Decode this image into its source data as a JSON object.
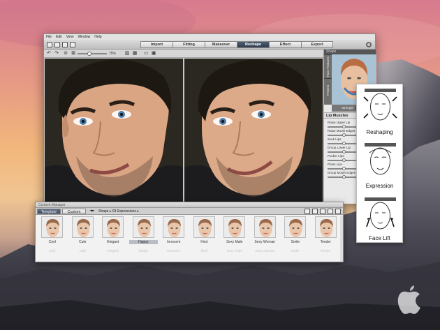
{
  "menu": [
    "File",
    "Edit",
    "View",
    "Window",
    "Help"
  ],
  "tabs": [
    {
      "label": "Import",
      "active": false
    },
    {
      "label": "Fitting",
      "active": false
    },
    {
      "label": "Makeover",
      "active": false
    },
    {
      "label": "Reshape",
      "active": true
    },
    {
      "label": "Effect",
      "active": false
    },
    {
      "label": "Export",
      "active": false
    }
  ],
  "zoom": "75%",
  "right_panel": {
    "header": "Shape",
    "vtabs": [
      "Face Features",
      "Presets"
    ],
    "strength_label": "Strength",
    "section_title": "Lip Muscles",
    "sliders": [
      {
        "label": "Raise Upper Lip",
        "value": 0.5
      },
      {
        "label": "Raise Mouth Edges",
        "value": 0.5
      },
      {
        "label": "Suck Lips",
        "value": 0.5
      },
      {
        "label": "Droop Lower Lip",
        "value": 0.5
      },
      {
        "label": "Pucker Lips",
        "value": 0.5
      },
      {
        "label": "Press Lips",
        "value": 0.5
      },
      {
        "label": "Droop Mouth Edges",
        "value": 0.5
      }
    ]
  },
  "content_manager": {
    "title": "Content Manager",
    "tab_template": "Template",
    "tab_custom": "Custom",
    "breadcrumb": "Shape ▸ 03 Expressions ▸",
    "items": [
      "Cool",
      "Cute",
      "Elegant",
      "Happy",
      "Innocent",
      "Kind",
      "Sexy Male",
      "Sexy Woman",
      "Smile",
      "Tender"
    ],
    "selected": "Happy",
    "ghost_row": [
      "cool",
      "cute",
      "elegant",
      "happy",
      "innocent",
      "kind",
      "sexy male",
      "sexy woman",
      "smile",
      "tender"
    ]
  },
  "feature_card": {
    "labels": [
      "Reshaping",
      "Expression",
      "Face Lift"
    ]
  },
  "colors": {
    "active_tab": "#3a4659",
    "template_tab": "#4c5b72"
  }
}
